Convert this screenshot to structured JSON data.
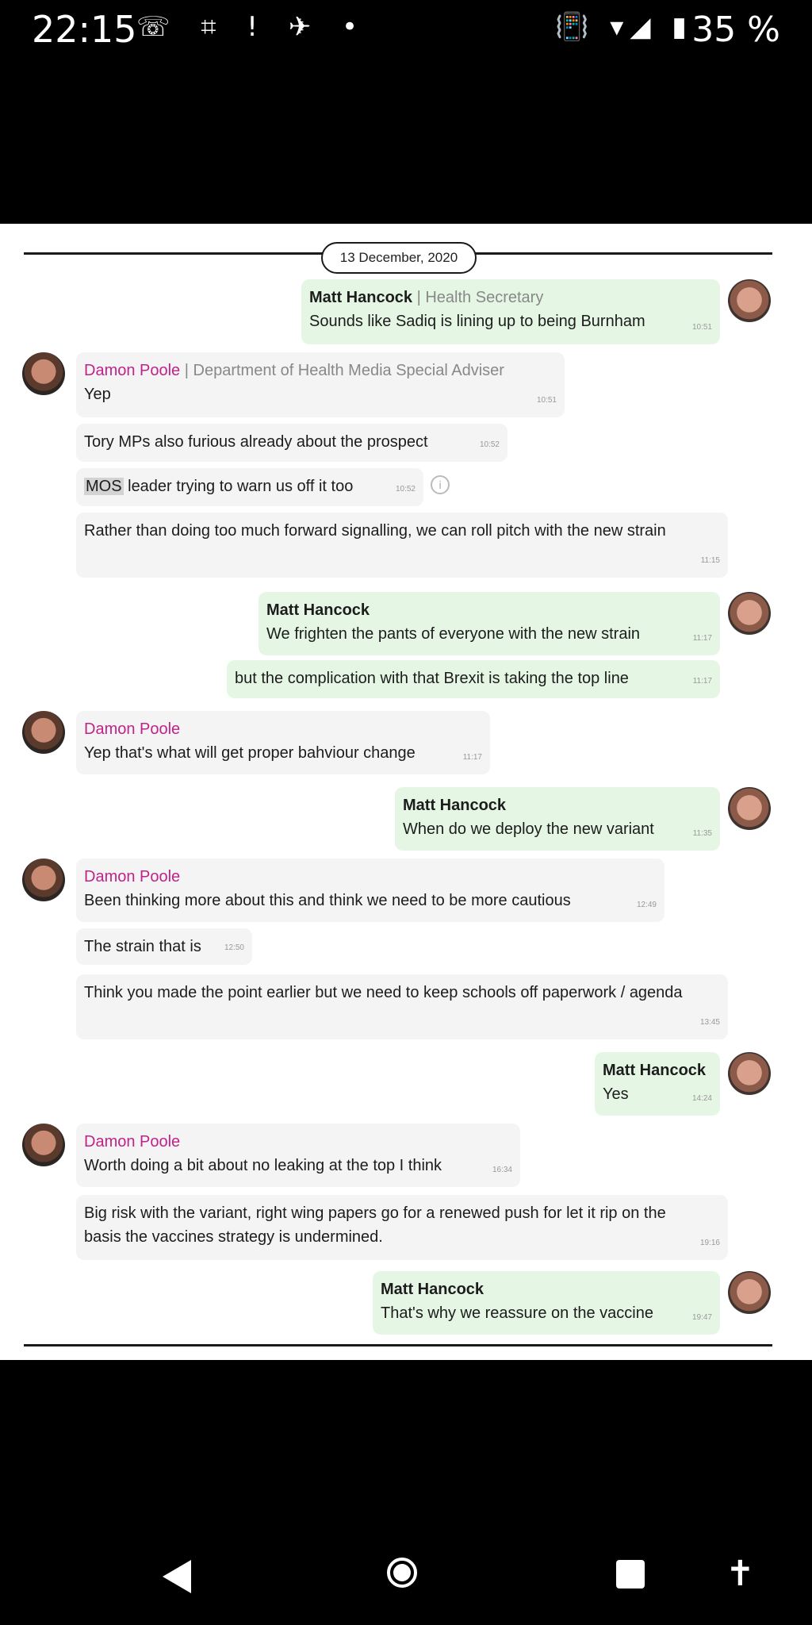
{
  "status_bar": {
    "time": "22:15",
    "left_icons": "☏ ⌗ ! ✈ •",
    "right_icons": "📳 ▾◢ ▮",
    "battery": "35 %"
  },
  "chat": {
    "date": "13 December, 2020",
    "messages": [
      {
        "sender": "Matt Hancock",
        "role": "Health Secretary",
        "text": "Sounds like Sadiq is lining up to being Burnham",
        "time": "10:51"
      },
      {
        "sender": "Damon Poole",
        "role": "Department of Health Media Special Adviser",
        "text": "Yep",
        "time": "10:51"
      },
      {
        "text": "Tory MPs also furious already about the prospect",
        "time": "10:52"
      },
      {
        "highlight": "MOS",
        "text": " leader trying to warn us off it too",
        "time": "10:52"
      },
      {
        "text": "Rather than doing too much forward signalling, we can roll pitch with the new strain",
        "time": "11:15"
      },
      {
        "sender": "Matt Hancock",
        "text": "We frighten the pants of everyone with the new strain",
        "time": "11:17"
      },
      {
        "text": "but the complication with that Brexit is taking the top line",
        "time": "11:17"
      },
      {
        "sender": "Damon Poole",
        "text": "Yep that's what will get proper bahviour change",
        "time": "11:17"
      },
      {
        "sender": "Matt Hancock",
        "text": "When do we deploy the new variant",
        "time": "11:35"
      },
      {
        "sender": "Damon Poole",
        "text": "Been thinking more about this and think we need to be more cautious",
        "time": "12:49"
      },
      {
        "text": "The strain that is",
        "time": "12:50"
      },
      {
        "text": "Think you made the point earlier but we need to keep schools off paperwork / agenda",
        "time": "13:45"
      },
      {
        "sender": "Matt Hancock",
        "text": "Yes",
        "time": "14:24"
      },
      {
        "sender": "Damon Poole",
        "text": "Worth doing a bit about no leaking at the top I think",
        "time": "16:34"
      },
      {
        "text": "Big risk with the variant, right wing papers go for a renewed push for let it rip on the basis the vaccines strategy is undermined.",
        "time": "19:16"
      },
      {
        "sender": "Matt Hancock",
        "text": "That's why we reassure on the vaccine",
        "time": "19:47"
      }
    ]
  },
  "icons": {
    "info": "i",
    "accessibility": "✝"
  }
}
